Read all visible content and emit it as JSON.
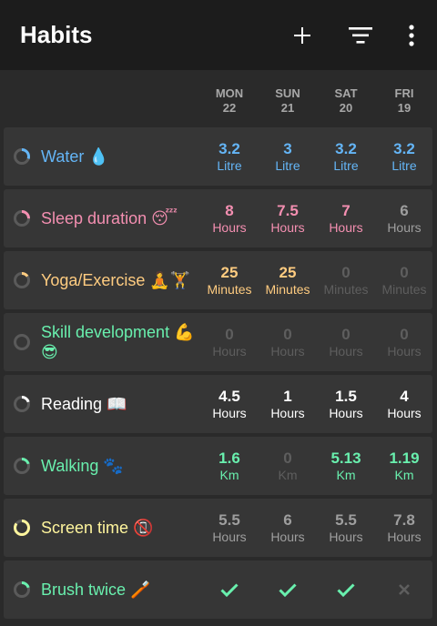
{
  "app": {
    "title": "Habits"
  },
  "days": [
    {
      "name": "MON",
      "date": "22"
    },
    {
      "name": "SUN",
      "date": "21"
    },
    {
      "name": "SAT",
      "date": "20"
    },
    {
      "name": "FRI",
      "date": "19"
    }
  ],
  "colors": {
    "blue": "#64b5f6",
    "pink": "#f48fb1",
    "orange": "#ffcc80",
    "green": "#69f0ae",
    "white": "#ffffff",
    "grey": "#9e9e9e",
    "dim": "#5e5e5e",
    "yellow": "#fff59d"
  },
  "habits": [
    {
      "name": "Water 💧",
      "color": "#64b5f6",
      "progress": 0.3,
      "entries": [
        {
          "value": "3.2",
          "unit": "Litre",
          "color": "#64b5f6"
        },
        {
          "value": "3",
          "unit": "Litre",
          "color": "#64b5f6"
        },
        {
          "value": "3.2",
          "unit": "Litre",
          "color": "#64b5f6"
        },
        {
          "value": "3.2",
          "unit": "Litre",
          "color": "#64b5f6"
        }
      ]
    },
    {
      "name": "Sleep duration 😴",
      "color": "#f48fb1",
      "progress": 0.25,
      "entries": [
        {
          "value": "8",
          "unit": "Hours",
          "color": "#f48fb1"
        },
        {
          "value": "7.5",
          "unit": "Hours",
          "color": "#f48fb1"
        },
        {
          "value": "7",
          "unit": "Hours",
          "color": "#f48fb1"
        },
        {
          "value": "6",
          "unit": "Hours",
          "color": "#9e9e9e"
        }
      ]
    },
    {
      "name": "Yoga/Exercise 🧘🏋",
      "color": "#ffcc80",
      "progress": 0.15,
      "entries": [
        {
          "value": "25",
          "unit": "Minutes",
          "color": "#ffcc80"
        },
        {
          "value": "25",
          "unit": "Minutes",
          "color": "#ffcc80"
        },
        {
          "value": "0",
          "unit": "Minutes",
          "color": "#5e5e5e"
        },
        {
          "value": "0",
          "unit": "Minutes",
          "color": "#5e5e5e"
        }
      ]
    },
    {
      "name": "Skill development 💪😎",
      "color": "#69f0ae",
      "progress": 0,
      "entries": [
        {
          "value": "0",
          "unit": "Hours",
          "color": "#5e5e5e"
        },
        {
          "value": "0",
          "unit": "Hours",
          "color": "#5e5e5e"
        },
        {
          "value": "0",
          "unit": "Hours",
          "color": "#5e5e5e"
        },
        {
          "value": "0",
          "unit": "Hours",
          "color": "#5e5e5e"
        }
      ]
    },
    {
      "name": "Reading 📖",
      "color": "#ffffff",
      "progress": 0.2,
      "entries": [
        {
          "value": "4.5",
          "unit": "Hours",
          "color": "#ffffff"
        },
        {
          "value": "1",
          "unit": "Hours",
          "color": "#ffffff"
        },
        {
          "value": "1.5",
          "unit": "Hours",
          "color": "#ffffff"
        },
        {
          "value": "4",
          "unit": "Hours",
          "color": "#ffffff"
        }
      ]
    },
    {
      "name": "Walking 🐾",
      "color": "#69f0ae",
      "progress": 0.2,
      "entries": [
        {
          "value": "1.6",
          "unit": "Km",
          "color": "#69f0ae"
        },
        {
          "value": "0",
          "unit": "Km",
          "color": "#5e5e5e"
        },
        {
          "value": "5.13",
          "unit": "Km",
          "color": "#69f0ae"
        },
        {
          "value": "1.19",
          "unit": "Km",
          "color": "#69f0ae"
        }
      ]
    },
    {
      "name": "Screen time 📵",
      "color": "#fff59d",
      "progress": 0.85,
      "entries": [
        {
          "value": "5.5",
          "unit": "Hours",
          "color": "#9e9e9e"
        },
        {
          "value": "6",
          "unit": "Hours",
          "color": "#9e9e9e"
        },
        {
          "value": "5.5",
          "unit": "Hours",
          "color": "#9e9e9e"
        },
        {
          "value": "7.8",
          "unit": "Hours",
          "color": "#9e9e9e"
        }
      ]
    },
    {
      "name": "Brush twice 🪥",
      "color": "#69f0ae",
      "progress": 0.2,
      "entries": [
        {
          "check": true,
          "color": "#69f0ae"
        },
        {
          "check": true,
          "color": "#69f0ae"
        },
        {
          "check": true,
          "color": "#69f0ae"
        },
        {
          "check": false,
          "color": "#5e5e5e"
        }
      ]
    }
  ],
  "icons": {
    "add": "add-icon",
    "filter": "filter-icon",
    "more": "more-vert-icon"
  }
}
